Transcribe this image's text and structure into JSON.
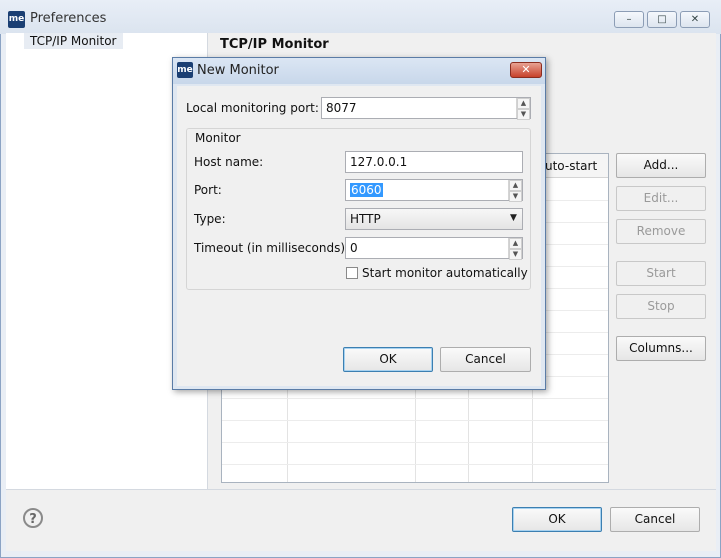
{
  "window": {
    "icon_text": "me",
    "title": "Preferences",
    "min_glyph": "–",
    "max_glyph": "□",
    "close_glyph": "✕"
  },
  "tree": {
    "selected_item": "TCP/IP Monitor"
  },
  "page": {
    "title": "TCP/IP Monitor",
    "table_header_visible": "uto-start",
    "buttons": {
      "add": "Add...",
      "edit": "Edit...",
      "remove": "Remove",
      "start": "Start",
      "stop": "Stop",
      "columns": "Columns..."
    }
  },
  "footer": {
    "help_glyph": "?",
    "ok": "OK",
    "cancel": "Cancel"
  },
  "dialog": {
    "icon_text": "me",
    "title": "New Monitor",
    "close_glyph": "✕",
    "local_port_label": "Local monitoring port:",
    "local_port_value": "8077",
    "group_label": "Monitor",
    "host_label": "Host name:",
    "host_value": "127.0.0.1",
    "port_label": "Port:",
    "port_value": "6060",
    "type_label": "Type:",
    "type_value": "HTTP",
    "timeout_label": "Timeout (in milliseconds):",
    "timeout_value": "0",
    "autostart_label": "Start monitor automatically",
    "autostart_checked": false,
    "ok": "OK",
    "cancel": "Cancel"
  }
}
